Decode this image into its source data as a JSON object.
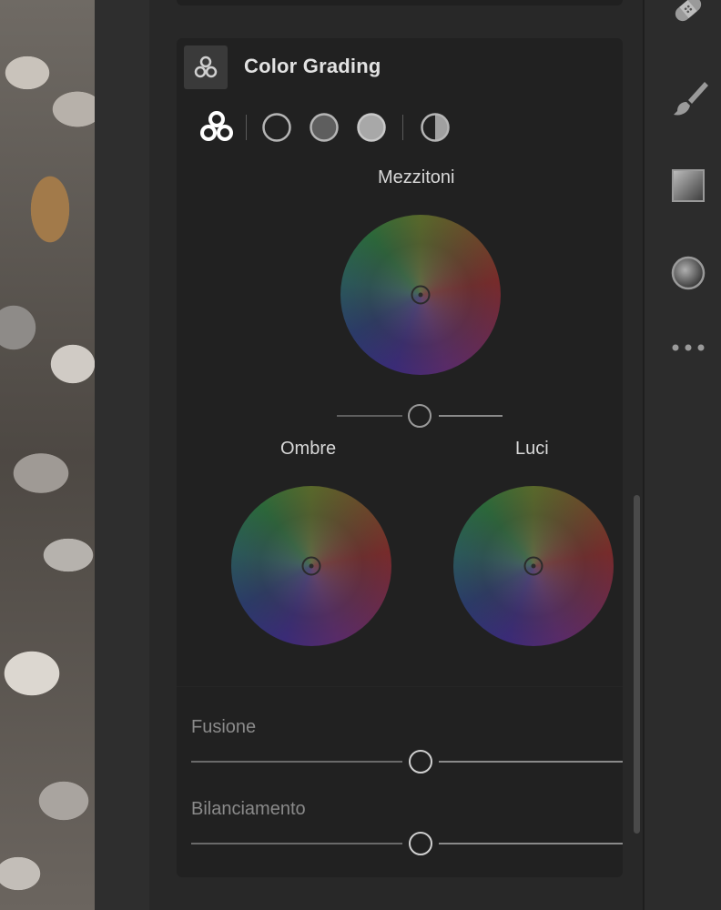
{
  "panel": {
    "title": "Color Grading",
    "modes": [
      {
        "icon": "three-circles-icon",
        "selected": true
      },
      {
        "icon": "shadows-circle-icon",
        "selected": false
      },
      {
        "icon": "midtones-circle-icon",
        "selected": false
      },
      {
        "icon": "highlights-circle-icon",
        "selected": false
      },
      {
        "icon": "global-half-circle-icon",
        "selected": false
      }
    ],
    "wheels": {
      "midtones": {
        "label": "Mezzitoni",
        "luminance": 0.5
      },
      "shadows": {
        "label": "Ombre"
      },
      "highlights": {
        "label": "Luci"
      }
    },
    "blending": {
      "label": "Fusione",
      "value": 0.5
    },
    "balance": {
      "label": "Bilanciamento",
      "value": 0.5
    }
  },
  "tools": [
    {
      "icon": "healing-bandage-icon"
    },
    {
      "icon": "brush-icon"
    },
    {
      "icon": "linear-gradient-icon"
    },
    {
      "icon": "radial-gradient-icon"
    },
    {
      "icon": "more-dots-icon"
    }
  ],
  "colors": {
    "panel_bg": "#212121",
    "accent_white": "#ffffff",
    "knob": "#cfcfcf"
  }
}
